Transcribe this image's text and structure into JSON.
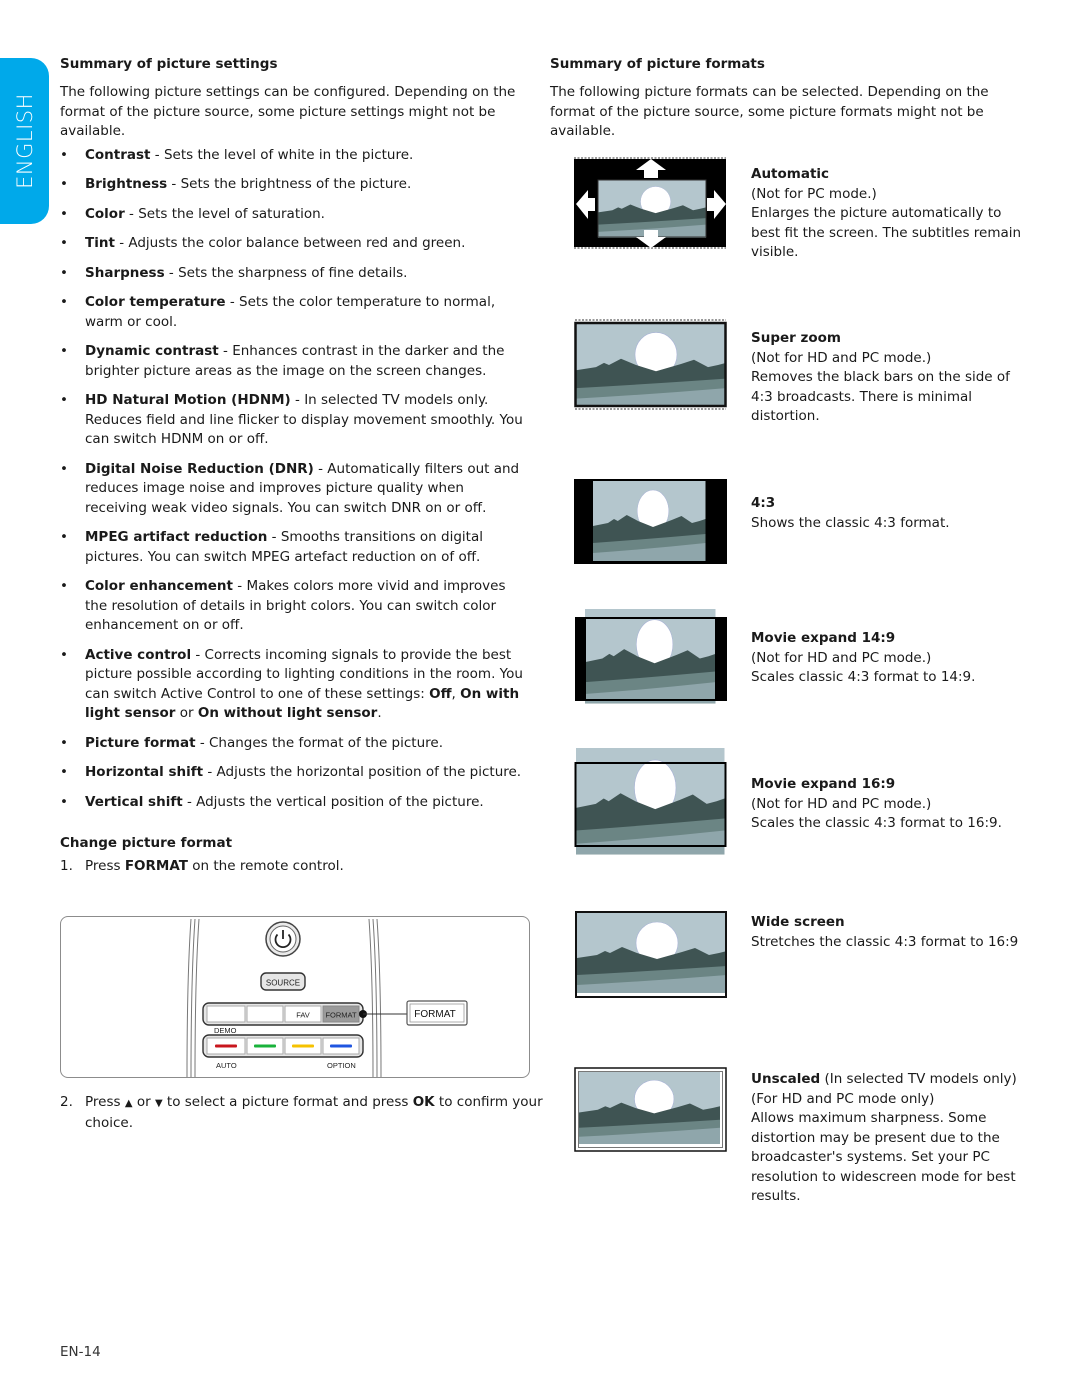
{
  "language_tab": "ENGLISH",
  "left": {
    "heading": "Summary of picture settings",
    "intro": "The following picture settings can be configured. Depending on the format of the picture source, some picture settings might not be available.",
    "bullet_char": "•",
    "settings": [
      {
        "term": "Contrast",
        "desc": " - Sets the level of white in the picture."
      },
      {
        "term": "Brightness",
        "desc": " - Sets the brightness of the picture."
      },
      {
        "term": "Color",
        "desc": " - Sets the level of saturation."
      },
      {
        "term": "Tint",
        "desc": " - Adjusts the color balance between red and green."
      },
      {
        "term": "Sharpness",
        "desc": " - Sets the sharpness of fine details."
      },
      {
        "term": "Color temperature",
        "desc": " - Sets the color temperature to normal, warm or cool."
      },
      {
        "term": "Dynamic contrast",
        "desc": " - Enhances contrast in the darker and the brighter picture areas as the image on the screen changes."
      },
      {
        "term": "HD Natural Motion (HDNM)",
        "desc": " - In selected TV models only. Reduces field and line flicker to display movement smoothly. You can switch HDNM on or off."
      },
      {
        "term": "Digital Noise Reduction (DNR)",
        "desc": " - Automatically filters out and reduces image noise and improves picture quality when receiving weak video signals. You can switch DNR on or off."
      },
      {
        "term": "MPEG artifact reduction",
        "desc": " - Smooths transitions on digital pictures. You can switch MPEG artefact reduction on of off."
      },
      {
        "term": "Color enhancement",
        "desc": " - Makes colors more vivid and improves the resolution of details in bright colors. You can switch color enhancement on or off."
      }
    ],
    "active_control": {
      "term": "Active control",
      "desc": " - Corrects incoming signals to provide the best picture possible according to lighting conditions in the room. You can switch Active Control to one of these settings: ",
      "opt1": "Off",
      "sep1": ", ",
      "opt2": "On with light sensor",
      "sep2": " or ",
      "opt3": "On without light sensor",
      "end": "."
    },
    "settings_after": [
      {
        "term": "Picture format",
        "desc": " - Changes the format of the picture."
      },
      {
        "term": "Horizontal shift",
        "desc": " - Adjusts the horizontal position of the picture."
      },
      {
        "term": "Vertical shift",
        "desc": " - Adjusts the vertical position of the picture."
      }
    ],
    "change_heading": "Change picture format",
    "step1": {
      "num": "1.",
      "pre": "Press ",
      "key": "FORMAT",
      "post": " on the remote control."
    },
    "step2": {
      "num": "2.",
      "pre": "Press ",
      "up": "▲",
      "mid": " or ",
      "down": "▼",
      "mid2": " to select a picture format and press ",
      "key": "OK",
      "post": " to confirm your choice."
    }
  },
  "remote": {
    "source_label": "SOURCE",
    "fav_label": "FAV",
    "format_label": "FORMAT",
    "callout_label": "FORMAT",
    "demo_label": "DEMO",
    "auto_label": "AUTO",
    "option_label": "OPTION",
    "color_keys": [
      "#c8161d",
      "#19b23b",
      "#f6c200",
      "#1f55e0"
    ],
    "power_icon": "⏻"
  },
  "right": {
    "heading": "Summary of picture formats",
    "intro": "The following picture formats can be selected. Depending on the format of the picture source, some picture formats might not be available.",
    "formats": [
      {
        "title": "Automatic",
        "title_note": "",
        "lines": [
          "(Not for PC mode.)",
          "Enlarges the picture automatically to best fit the screen. The subtitles remain visible."
        ]
      },
      {
        "title": "Super zoom",
        "title_note": "",
        "lines": [
          "(Not for HD and PC mode.)",
          "Removes the black bars on the side of 4:3 broadcasts. There is minimal distortion."
        ]
      },
      {
        "title": "4:3",
        "title_note": "",
        "lines": [
          "Shows the classic 4:3 format."
        ]
      },
      {
        "title": "Movie expand 14:9",
        "title_note": "",
        "lines": [
          "(Not for HD and PC mode.)",
          "Scales classic 4:3 format to 14:9."
        ]
      },
      {
        "title": "Movie expand 16:9",
        "title_note": "",
        "lines": [
          "(Not for HD and PC mode.)",
          "Scales the classic 4:3 format to 16:9."
        ]
      },
      {
        "title": "Wide screen",
        "title_note": "",
        "lines": [
          "Stretches the classic 4:3 format to 16:9"
        ]
      },
      {
        "title": "Unscaled",
        "title_note": " (In selected TV models only)",
        "lines": [
          "(For HD and PC mode only)",
          "Allows maximum sharpness. Some distortion may be present due to the broadcaster's systems.  Set your PC resolution to widescreen mode for best results."
        ]
      }
    ]
  },
  "colors": {
    "language_tab": "#00a9ea",
    "sky": "#b4c6cd",
    "mountain": "#3f5453",
    "field_mid": "#6b8584",
    "field_low": "#8fa6ab"
  },
  "page_number": "EN-14"
}
